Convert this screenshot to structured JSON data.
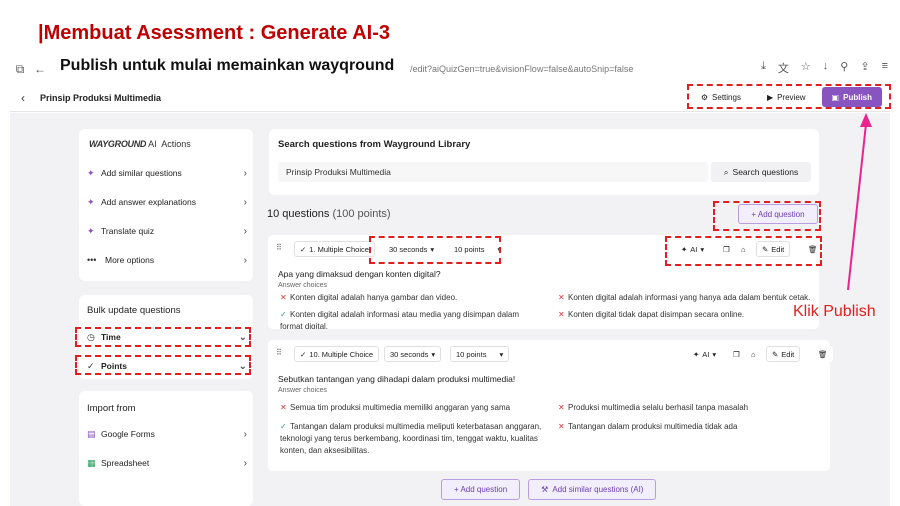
{
  "slide": {
    "bar": "|",
    "title": "Membuat Asessment : Generate AI-3"
  },
  "caption": "Publish untuk mulai memainkan wayqround",
  "browser": {
    "url": "/edit?aiQuizGen=true&visionFlow=false&autoSnip=false"
  },
  "header": {
    "quiz_name": "Prinsip Produksi Multimedia",
    "settings": "Settings",
    "preview": "Preview",
    "publish": "Publish"
  },
  "ai_panel": {
    "brand": "WAYGROUND",
    "brand_ai": "AI",
    "actions_label": "Actions",
    "items": [
      "Add similar questions",
      "Add answer explanations",
      "Translate quiz",
      "More options"
    ]
  },
  "bulk": {
    "title": "Bulk update questions",
    "time": "Time",
    "points": "Points"
  },
  "import": {
    "title": "Import from",
    "google_forms": "Google Forms",
    "spreadsheet": "Spreadsheet"
  },
  "search": {
    "title": "Search questions from Wayground Library",
    "value": "Prinsip Produksi Multimedia",
    "button": "Search questions"
  },
  "questions": {
    "count": "10 questions",
    "points": "(100 points)",
    "add_question": "+ Add question"
  },
  "q1": {
    "type": "1. Multiple Choice",
    "time": "30 seconds",
    "points": "10 points",
    "ai": "AI",
    "edit": "Edit",
    "text": "Apa yang dimaksud dengan konten digital?",
    "answer_label": "Answer choices",
    "answers": [
      "Konten digital adalah hanya gambar dan video.",
      "Konten digital adalah informasi yang hanya ada dalam bentuk cetak.",
      "Konten digital adalah informasi atau media yang disimpan dalam format digital.",
      "Konten digital tidak dapat disimpan secara online."
    ]
  },
  "q2": {
    "type": "10. Multiple Choice",
    "time": "30 seconds",
    "points": "10 points",
    "ai": "AI",
    "edit": "Edit",
    "text": "Sebutkan tantangan yang dihadapi dalam produksi multimedia!",
    "answer_label": "Answer choices",
    "answers": [
      "Semua tim produksi multimedia memiliki anggaran yang sama",
      "Produksi multimedia selalu berhasil tanpa masalah",
      "Tantangan dalam produksi multimedia meliputi keterbatasan anggaran, teknologi yang terus berkembang, koordinasi tim, tenggat waktu, kualitas konten, dan aksesibilitas.",
      "Tantangan dalam produksi multimedia tidak ada"
    ]
  },
  "bottom": {
    "add_question": "+ Add question",
    "add_similar": "Add similar questions (AI)"
  },
  "annotation": {
    "klik_publish": "Klik Publish",
    "color": "#e02020"
  }
}
